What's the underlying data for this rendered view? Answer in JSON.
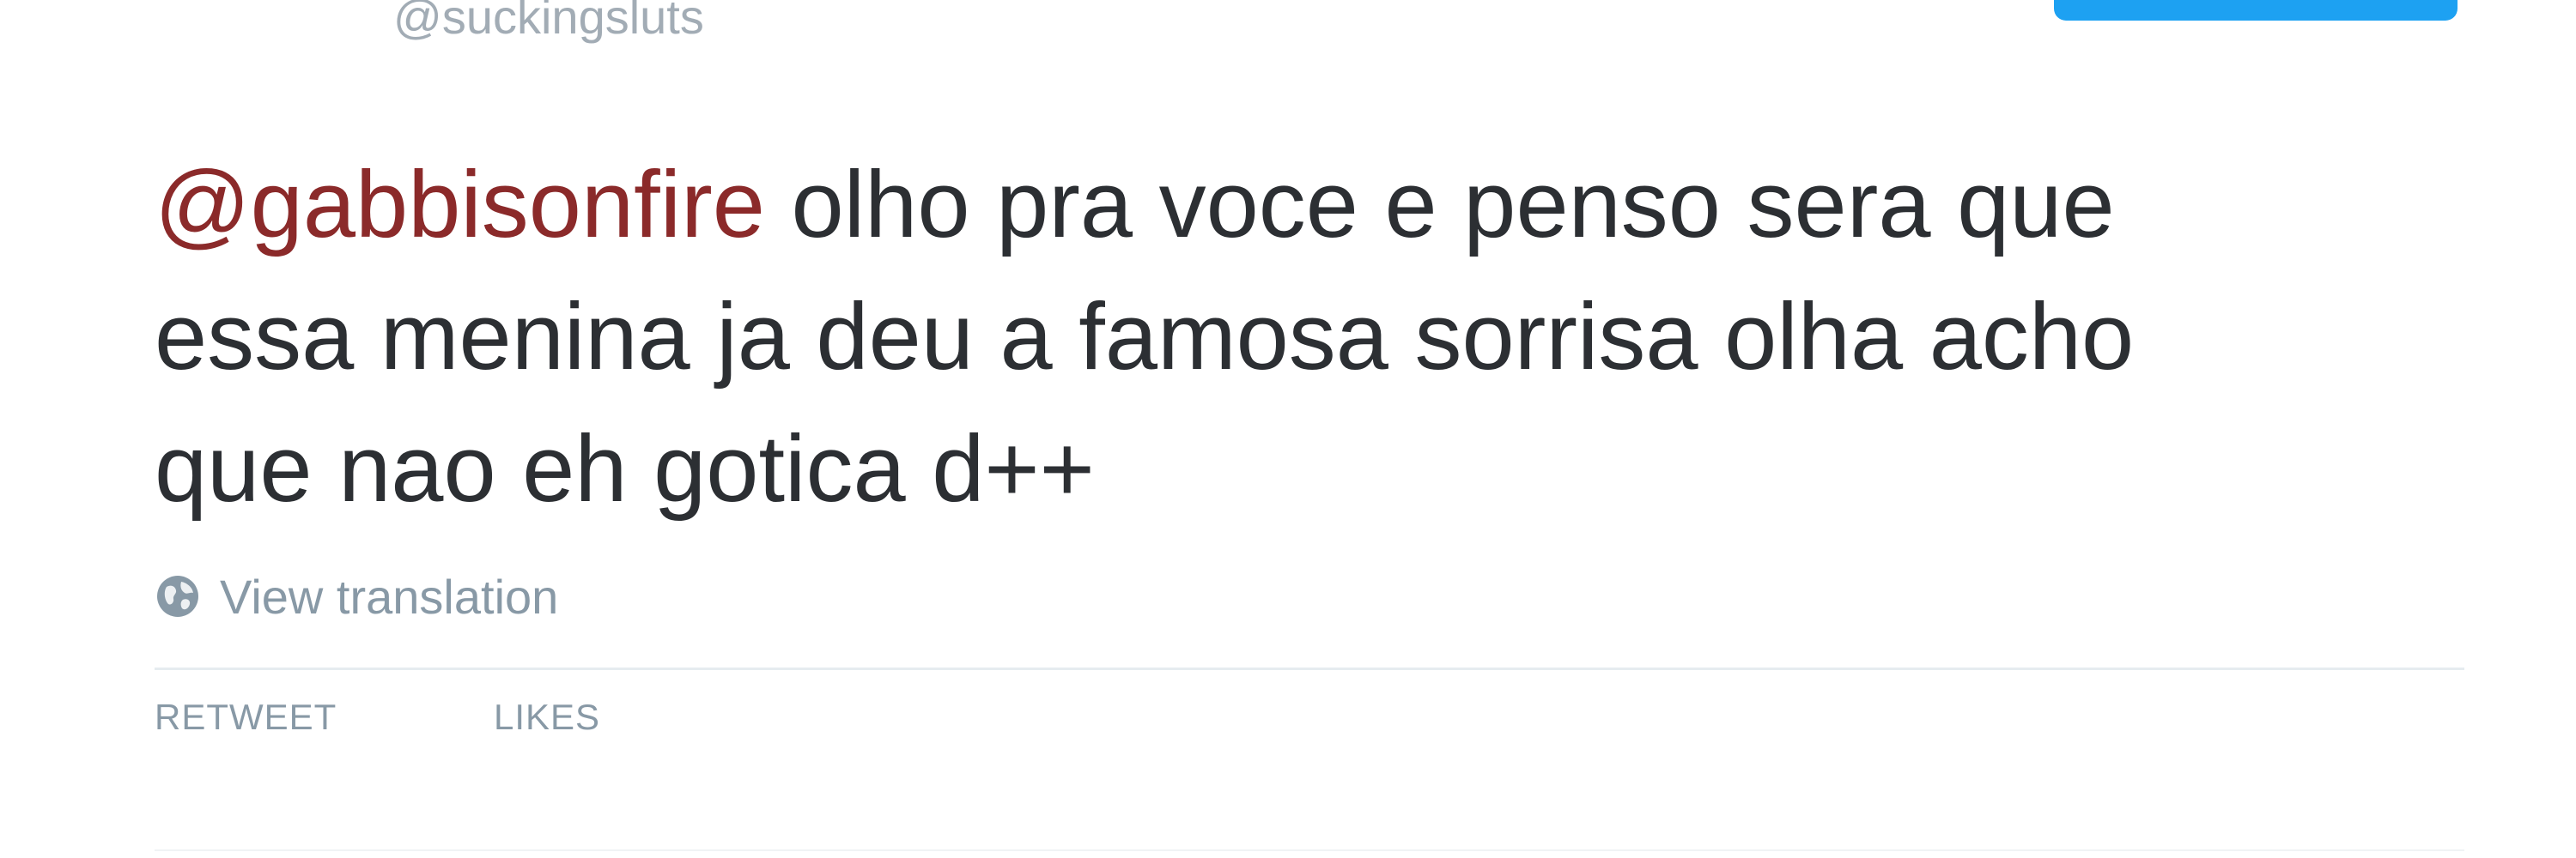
{
  "tweet": {
    "handle": "@suckingsluts",
    "mention": "@gabbisonfire",
    "text_line1_rest": " olho pra voce e penso sera que",
    "text_line2": "essa menina ja deu a famosa sorrisa olha acho",
    "text_line3": "que nao eh gotica d++",
    "translation_label": "View translation",
    "translation_icon": "globe-icon"
  },
  "stats": {
    "retweet_label": "RETWEET",
    "likes_label": "LIKES"
  },
  "colors": {
    "mention": "#8b2a2a",
    "text": "#2c2f33",
    "muted": "#8899a6",
    "accent": "#1da1f2"
  }
}
